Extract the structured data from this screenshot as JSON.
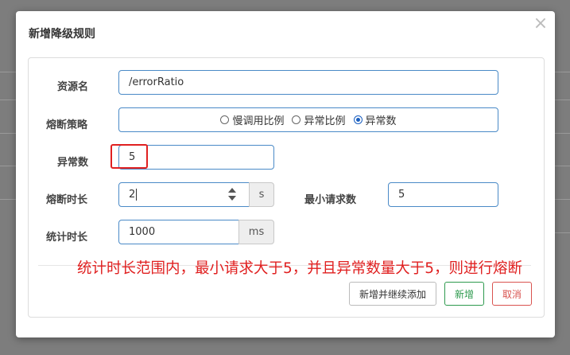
{
  "dialog": {
    "title": "新增降级规则",
    "close_glyph": "×"
  },
  "form": {
    "resource": {
      "label": "资源名",
      "value": "/errorRatio"
    },
    "strategy": {
      "label": "熔断策略",
      "options": [
        "慢调用比例",
        "异常比例",
        "异常数"
      ],
      "selected": "异常数"
    },
    "exception_count": {
      "label": "异常数",
      "value": "5"
    },
    "break_duration": {
      "label": "熔断时长",
      "value": "2",
      "unit": "s"
    },
    "min_requests": {
      "label": "最小请求数",
      "value": "5"
    },
    "stat_duration": {
      "label": "统计时长",
      "value": "1000",
      "unit": "ms"
    }
  },
  "annotation": "统计时长范围内，最小请求大于5，并且异常数量大于5，则进行熔断",
  "buttons": {
    "add_continue": "新增并继续添加",
    "add": "新增",
    "cancel": "取消"
  },
  "colors": {
    "accent_border": "#4a8ac7",
    "highlight": "#e02020",
    "add_button": "#2e9a4e",
    "cancel_button": "#d9534f"
  },
  "icons": {
    "close": "close-icon",
    "spinner": "spinner-icon"
  }
}
